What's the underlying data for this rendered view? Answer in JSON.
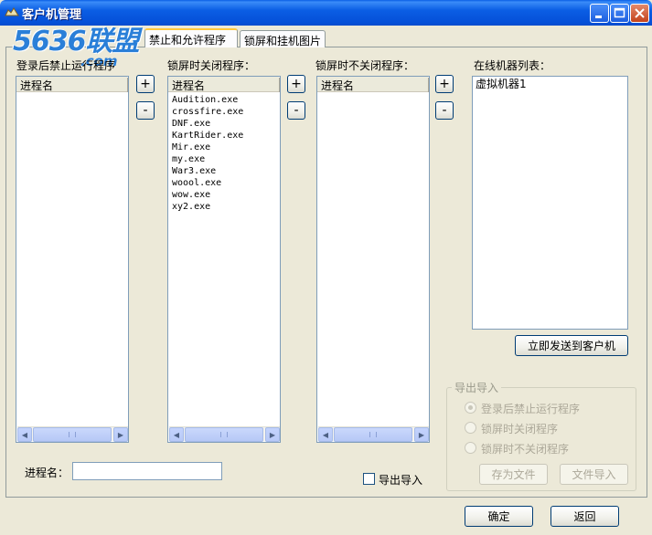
{
  "window": {
    "title": "客户机管理"
  },
  "watermark": {
    "logo": "5636联盟",
    "sub": ".com"
  },
  "tabs": [
    {
      "label": "禁止和允许程序",
      "active": true
    },
    {
      "label": "锁屏和挂机图片",
      "active": false
    }
  ],
  "lists": {
    "blocked_after_login": {
      "label": "登录后禁止运行程序",
      "column": "进程名",
      "items": []
    },
    "close_on_lock": {
      "label": "锁屏时关闭程序：",
      "column": "进程名",
      "items": [
        "Audition.exe",
        "crossfire.exe",
        "DNF.exe",
        "KartRider.exe",
        "Mir.exe",
        "my.exe",
        "War3.exe",
        "woool.exe",
        "wow.exe",
        "xy2.exe"
      ]
    },
    "keep_on_lock": {
      "label": "锁屏时不关闭程序：",
      "column": "进程名",
      "items": []
    },
    "online_machines": {
      "label": "在线机器列表：",
      "items": [
        "虚拟机器1"
      ]
    }
  },
  "buttons": {
    "add": "+",
    "remove": "-",
    "send": "立即发送到客户机",
    "ok": "确定",
    "back": "返回"
  },
  "process_name": {
    "label": "进程名：",
    "value": ""
  },
  "export_import_checkbox": {
    "label": "导出导入",
    "checked": false
  },
  "export_import_group": {
    "title": "导出导入",
    "options": [
      "登录后禁止运行程序",
      "锁屏时关闭程序",
      "锁屏时不关闭程序"
    ],
    "selected_index": 0,
    "save_file": "存为文件",
    "import_file": "文件导入"
  }
}
